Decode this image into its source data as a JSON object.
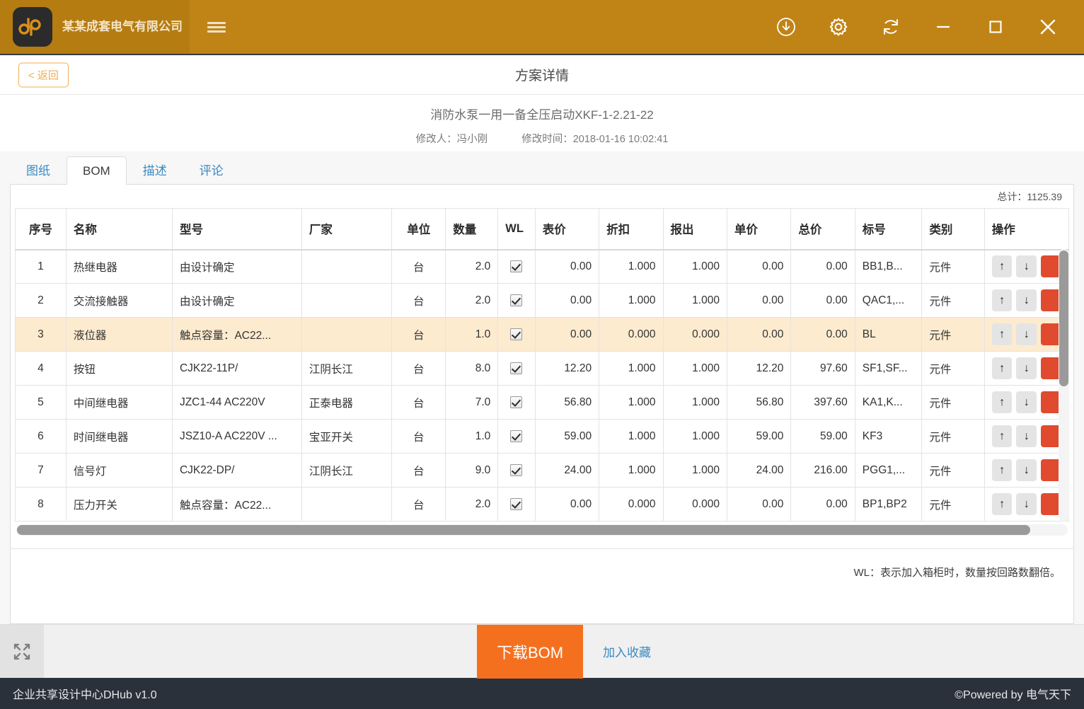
{
  "titlebar": {
    "brand_name": "某某成套电气有限公司",
    "logo_alt": "dhub-logo",
    "icons": [
      {
        "name": "download-circle-icon",
        "label": "下载"
      },
      {
        "name": "gear-icon",
        "label": "设置"
      },
      {
        "name": "refresh-icon",
        "label": "刷新"
      },
      {
        "name": "minimize-icon",
        "label": "最小化"
      },
      {
        "name": "maximize-icon",
        "label": "最大化"
      },
      {
        "name": "close-icon",
        "label": "关闭"
      }
    ]
  },
  "subheader": {
    "back_label": "< 返回",
    "page_title": "方案详情"
  },
  "meta": {
    "scheme_title": "消防水泵一用一备全压启动XKF-1-2.21-22",
    "modifier_label": "修改人：冯小刚",
    "modified_label": "修改时间：2018-01-16 10:02:41"
  },
  "tabs": [
    {
      "label": "图纸",
      "active": false
    },
    {
      "label": "BOM",
      "active": true
    },
    {
      "label": "描述",
      "active": false
    },
    {
      "label": "评论",
      "active": false
    }
  ],
  "table": {
    "total_label": "总计：1125.39",
    "headers": [
      "序号",
      "名称",
      "型号",
      "厂家",
      "单位",
      "数量",
      "WL",
      "表价",
      "折扣",
      "报出",
      "单价",
      "总价",
      "标号",
      "类别",
      "操作"
    ],
    "rows": [
      {
        "idx": "1",
        "name": "热继电器",
        "model": "由设计确定",
        "maker": "",
        "unit": "台",
        "qty": "2.0",
        "wl": true,
        "list_price": "0.00",
        "discount": "1.000",
        "quoted": "1.000",
        "unit_price": "0.00",
        "total_price": "0.00",
        "tag": "BB1,B...",
        "category": "元件",
        "highlight": false
      },
      {
        "idx": "2",
        "name": "交流接触器",
        "model": "由设计确定",
        "maker": "",
        "unit": "台",
        "qty": "2.0",
        "wl": true,
        "list_price": "0.00",
        "discount": "1.000",
        "quoted": "1.000",
        "unit_price": "0.00",
        "total_price": "0.00",
        "tag": "QAC1,...",
        "category": "元件",
        "highlight": false
      },
      {
        "idx": "3",
        "name": "液位器",
        "model": "触点容量：AC22...",
        "maker": "",
        "unit": "台",
        "qty": "1.0",
        "wl": true,
        "list_price": "0.00",
        "discount": "0.000",
        "quoted": "0.000",
        "unit_price": "0.00",
        "total_price": "0.00",
        "tag": "BL",
        "category": "元件",
        "highlight": true
      },
      {
        "idx": "4",
        "name": "按钮",
        "model": "CJK22-11P/",
        "maker": "江阴长江",
        "unit": "台",
        "qty": "8.0",
        "wl": true,
        "list_price": "12.20",
        "discount": "1.000",
        "quoted": "1.000",
        "unit_price": "12.20",
        "total_price": "97.60",
        "tag": "SF1,SF...",
        "category": "元件",
        "highlight": false
      },
      {
        "idx": "5",
        "name": "中间继电器",
        "model": "JZC1-44 AC220V",
        "maker": "正泰电器",
        "unit": "台",
        "qty": "7.0",
        "wl": true,
        "list_price": "56.80",
        "discount": "1.000",
        "quoted": "1.000",
        "unit_price": "56.80",
        "total_price": "397.60",
        "tag": "KA1,K...",
        "category": "元件",
        "highlight": false
      },
      {
        "idx": "6",
        "name": "时间继电器",
        "model": "JSZ10-A AC220V ...",
        "maker": "宝亚开关",
        "unit": "台",
        "qty": "1.0",
        "wl": true,
        "list_price": "59.00",
        "discount": "1.000",
        "quoted": "1.000",
        "unit_price": "59.00",
        "total_price": "59.00",
        "tag": "KF3",
        "category": "元件",
        "highlight": false
      },
      {
        "idx": "7",
        "name": "信号灯",
        "model": "CJK22-DP/",
        "maker": "江阴长江",
        "unit": "台",
        "qty": "9.0",
        "wl": true,
        "list_price": "24.00",
        "discount": "1.000",
        "quoted": "1.000",
        "unit_price": "24.00",
        "total_price": "216.00",
        "tag": "PGG1,...",
        "category": "元件",
        "highlight": false
      },
      {
        "idx": "8",
        "name": "压力开关",
        "model": "触点容量：AC22...",
        "maker": "",
        "unit": "台",
        "qty": "2.0",
        "wl": true,
        "list_price": "0.00",
        "discount": "0.000",
        "quoted": "0.000",
        "unit_price": "0.00",
        "total_price": "0.00",
        "tag": "BP1,BP2",
        "category": "元件",
        "highlight": false
      }
    ],
    "row_ops": {
      "up": "↑",
      "down": "↓",
      "delete": ""
    },
    "note": "WL：表示加入箱柜时，数量按回路数翻倍。"
  },
  "actionbar": {
    "fullscreen_icon": "fullscreen-icon",
    "download_label": "下载BOM",
    "favorite_label": "加入收藏"
  },
  "footer": {
    "left": "企业共享设计中心DHub v1.0",
    "right": "©Powered by 电气天下"
  },
  "colors": {
    "titlebar": "#c08416",
    "brand_block": "#b57c12",
    "accent_orange": "#f4701f",
    "link_blue": "#3a8ac0",
    "row_highlight": "#fdebcf",
    "delete_red": "#e04a2f",
    "footer_bg": "#2b313a"
  }
}
